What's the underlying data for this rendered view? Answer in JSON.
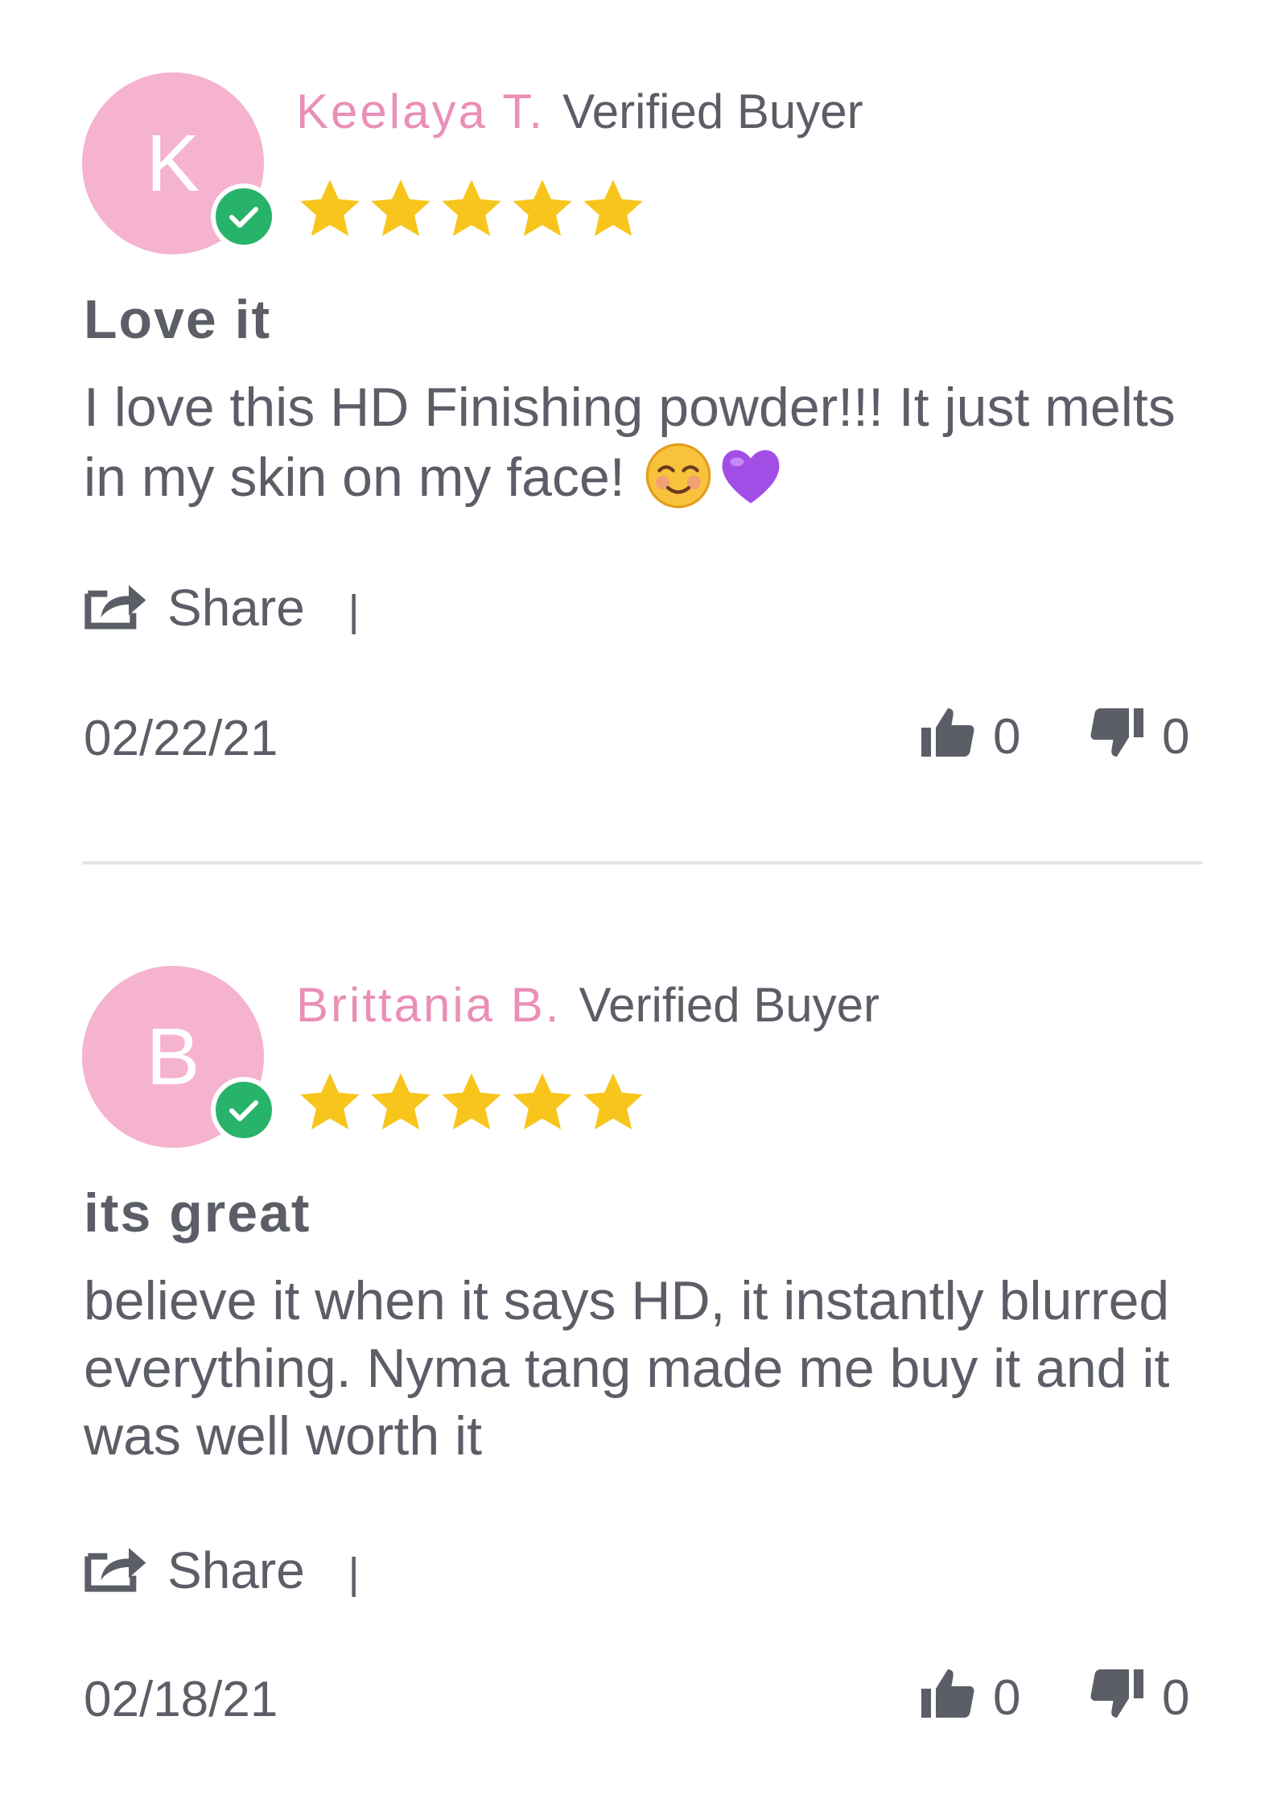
{
  "colors": {
    "avatar_bg": "#f5b3cf",
    "name": "#ea8fb7",
    "star": "#f8c51c",
    "verified": "#28b36b",
    "text": "#5b5e66",
    "divider": "#e4e4e6"
  },
  "reviews": [
    {
      "avatar_initial": "K",
      "name": "Keelaya T.",
      "tag": "Verified Buyer",
      "rating": 5,
      "title": "Love it",
      "body": "I love this HD Finishing powder!!! It just melts in my skin on my face!",
      "emojis": [
        "relieved-face-emoji",
        "purple-heart-emoji"
      ],
      "share_label": "Share",
      "separator": "|",
      "date": "02/22/21",
      "votes_up": "0",
      "votes_down": "0"
    },
    {
      "avatar_initial": "B",
      "name": "Brittania B.",
      "tag": "Verified Buyer",
      "rating": 5,
      "title": "its great",
      "body": "believe it when it says HD, it instantly blurred everything. Nyma tang made me buy it and it was well worth it",
      "emojis": [],
      "share_label": "Share",
      "separator": "|",
      "date": "02/18/21",
      "votes_up": "0",
      "votes_down": "0"
    }
  ]
}
